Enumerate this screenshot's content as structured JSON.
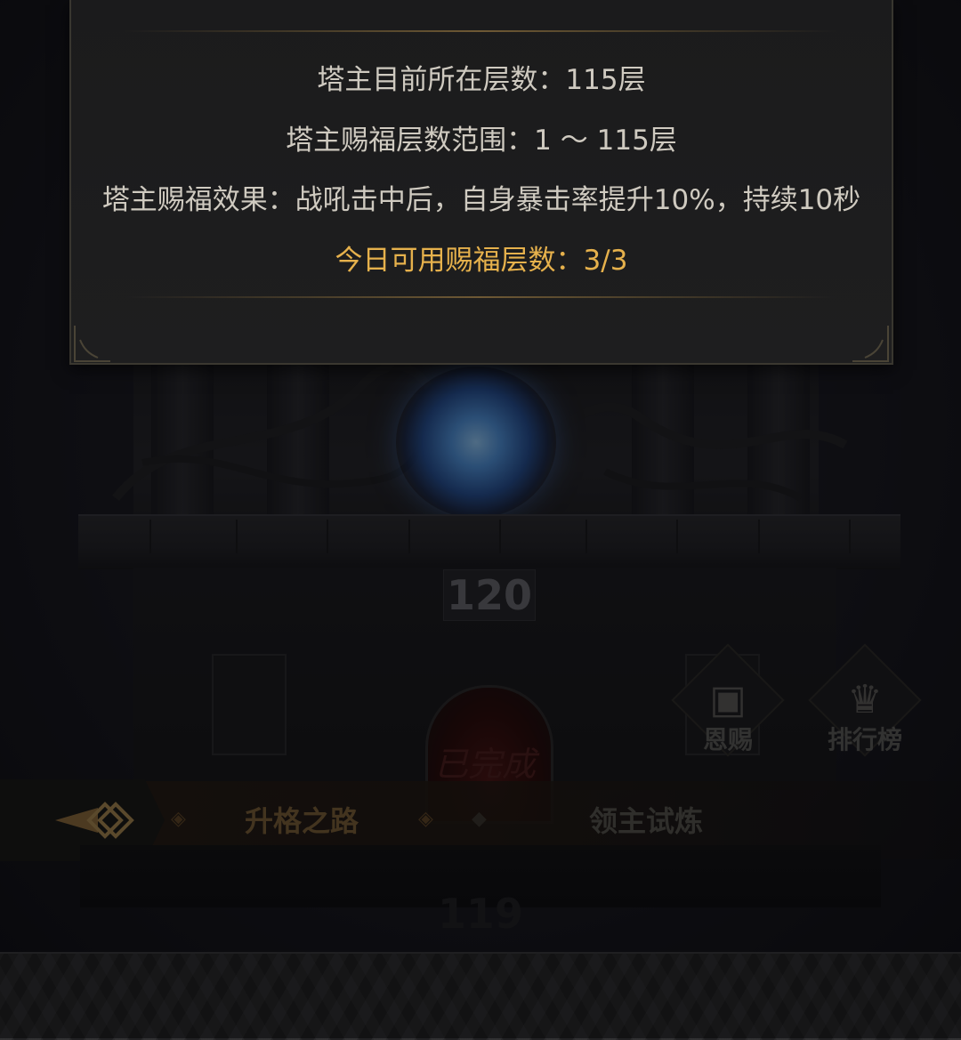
{
  "dialog": {
    "current_floor_text": "塔主目前所在层数：115层",
    "blessing_range_text": "塔主赐福层数范围：1 ～ 115层",
    "blessing_effect_text": "塔主赐福效果：战吼击中后，自身暴击率提升10%，持续10秒",
    "daily_blessing_text": "今日可用赐福层数：3/3",
    "highlight_color": "#e6b14c"
  },
  "tower": {
    "current_floor_number": "120",
    "floor_status": "已完成",
    "next_floor_number": "119"
  },
  "side_buttons": {
    "grace_label": "恩赐",
    "leaderboard_label": "排行榜"
  },
  "nav": {
    "tab_ascension": "升格之路",
    "tab_lord_trial": "领主试炼"
  },
  "icons": {
    "back": "double-diamond-arrow-icon",
    "grace": "treasure-chest-icon",
    "leaderboard": "crown-icon"
  }
}
